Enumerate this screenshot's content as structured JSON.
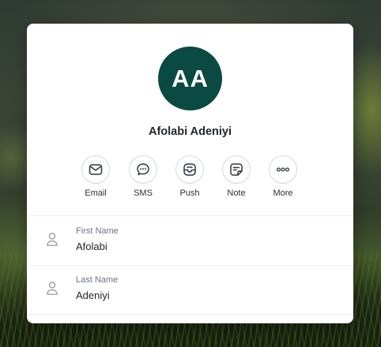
{
  "contact": {
    "initials": "AA",
    "full_name": "Afolabi Adeniyi",
    "avatar_color": "#0b4a42"
  },
  "actions": [
    {
      "label": "Email",
      "icon": "mail-icon"
    },
    {
      "label": "SMS",
      "icon": "chat-bubble-icon"
    },
    {
      "label": "Push",
      "icon": "inbox-icon"
    },
    {
      "label": "Note",
      "icon": "note-icon"
    },
    {
      "label": "More",
      "icon": "more-dots-icon"
    }
  ],
  "fields": [
    {
      "label": "First Name",
      "value": "Afolabi",
      "icon": "person-icon"
    },
    {
      "label": "Last Name",
      "value": "Adeniyi",
      "icon": "person-icon"
    }
  ]
}
